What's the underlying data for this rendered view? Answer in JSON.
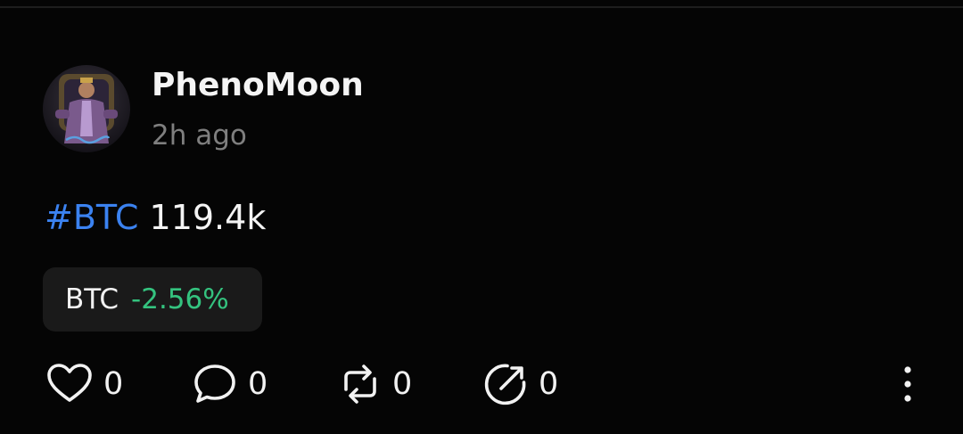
{
  "post": {
    "author": {
      "name": "PhenoMoon",
      "avatar_icon": "avatar-portrait-image"
    },
    "time": "2h ago",
    "text": {
      "hashtag": "#BTC",
      "value": "119.4k"
    },
    "ticker": {
      "symbol": "BTC",
      "change": "-2.56%",
      "change_color": "#34c37f"
    },
    "actions": {
      "like": {
        "icon": "heart-icon",
        "count": "0"
      },
      "comment": {
        "icon": "comment-bubble-icon",
        "count": "0"
      },
      "repost": {
        "icon": "repost-icon",
        "count": "0"
      },
      "share": {
        "icon": "share-icon",
        "count": "0"
      },
      "more": {
        "icon": "more-vertical-icon"
      }
    }
  },
  "colors": {
    "background": "#050505",
    "hashtag": "#3b82f0",
    "muted_text": "#7f7f7f",
    "chip_background": "#1a1a1a"
  }
}
